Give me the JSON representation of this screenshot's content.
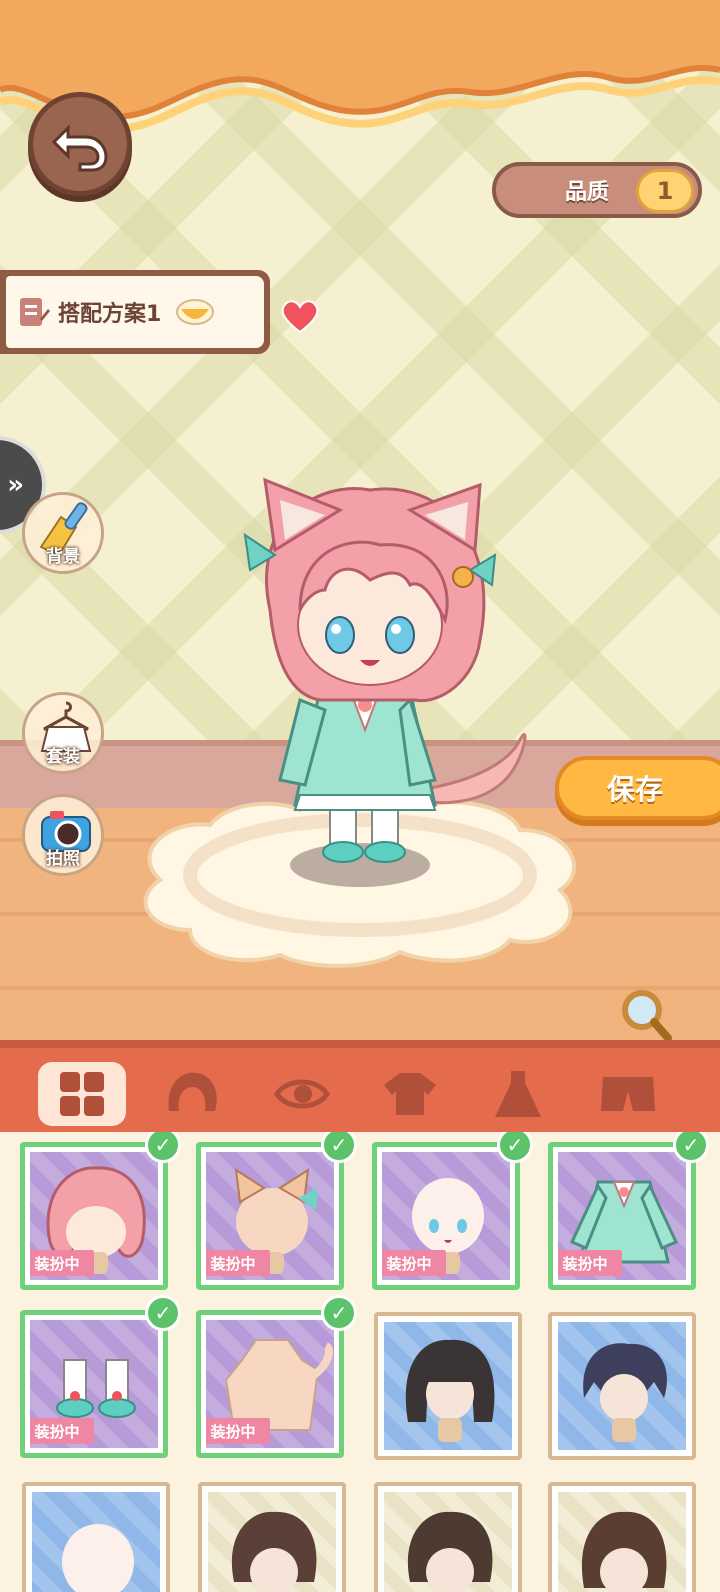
{
  "header": {
    "back_icon": "back-arrow-icon",
    "quality_label": "品质",
    "quality_value": "1"
  },
  "outfit_plan": {
    "name": "搭配方案1"
  },
  "side_buttons": {
    "background": "背景",
    "suit": "套装",
    "photo": "拍照"
  },
  "save_label": "保存",
  "category_tabs": [
    {
      "icon": "grid-all-icon",
      "selected": true
    },
    {
      "icon": "hair-icon",
      "selected": false
    },
    {
      "icon": "eye-icon",
      "selected": false
    },
    {
      "icon": "top-shirt-icon",
      "selected": false
    },
    {
      "icon": "dress-icon",
      "selected": false
    },
    {
      "icon": "shorts-icon",
      "selected": false
    }
  ],
  "items": [
    {
      "badge": "装扮中",
      "equipped": true,
      "bg": "purple",
      "item": "pink-hair"
    },
    {
      "badge": "装扮中",
      "equipped": true,
      "bg": "purple",
      "item": "cat-ears"
    },
    {
      "badge": "装扮中",
      "equipped": true,
      "bg": "purple",
      "item": "face"
    },
    {
      "badge": "装扮中",
      "equipped": true,
      "bg": "purple",
      "item": "mint-outfit"
    },
    {
      "badge": "装扮中",
      "equipped": true,
      "bg": "purple",
      "item": "socks-shoes"
    },
    {
      "badge": "装扮中",
      "equipped": true,
      "bg": "purple",
      "item": "cat-body"
    },
    {
      "badge": "",
      "equipped": false,
      "bg": "blue",
      "item": "black-long-hair"
    },
    {
      "badge": "",
      "equipped": false,
      "bg": "blue",
      "item": "navy-short-hair"
    },
    {
      "badge": "",
      "equipped": false,
      "bg": "blue",
      "item": "bald-head"
    },
    {
      "badge": "",
      "equipped": false,
      "bg": "cream",
      "item": "brown-hair-1"
    },
    {
      "badge": "",
      "equipped": false,
      "bg": "cream",
      "item": "brown-hair-2"
    },
    {
      "badge": "",
      "equipped": false,
      "bg": "cream",
      "item": "brown-hair-3"
    }
  ]
}
